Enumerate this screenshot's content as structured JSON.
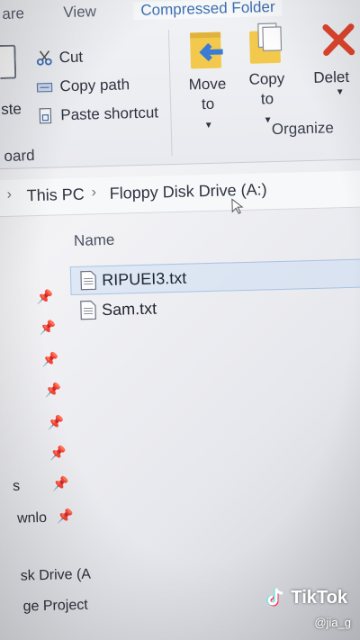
{
  "ribbon": {
    "tabs": [
      "are",
      "View",
      "Compressed Folder"
    ],
    "clipboard": {
      "paste_partial": "ste",
      "cut": "Cut",
      "copy_path": "Copy path",
      "paste_shortcut": "Paste shortcut",
      "group_partial": "oard"
    },
    "organize": {
      "move_to": "Move to",
      "copy_to": "Copy to",
      "delete_partial": "Delet",
      "group": "Organize"
    }
  },
  "address": {
    "crumbs": [
      "This PC",
      "Floppy Disk Drive (A:)"
    ]
  },
  "files": {
    "column_name": "Name",
    "items": [
      "RIPUEI3.txt",
      "Sam.txt"
    ]
  },
  "nav": {
    "partial_items": [
      "s",
      "wnlo",
      "sk Drive (A",
      "ge Project"
    ]
  },
  "watermark": {
    "brand": "TikTok",
    "handle": "@jia_g"
  },
  "colors": {
    "folder_yellow": "#f2c94c",
    "arrow_blue": "#3a7bd5",
    "delete_red": "#e0452e",
    "accent": "#3d6fb0"
  }
}
